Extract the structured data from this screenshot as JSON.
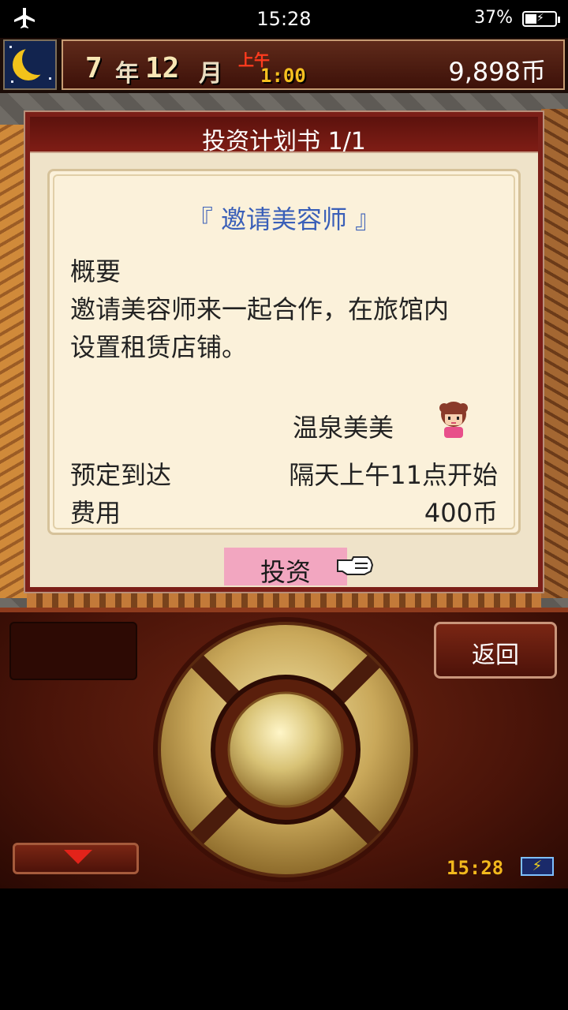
{
  "status_bar": {
    "time": "15:28",
    "battery_percent": "37%",
    "battery_level": 0.37,
    "icons": [
      "airplane-mode-icon",
      "battery-charging-icon"
    ]
  },
  "hud": {
    "year_num": "7",
    "year_unit": "年",
    "month_num": "12",
    "month_unit": "月",
    "am_pm": "上午",
    "clock": "1:00",
    "money": "9,898币",
    "icon": "crescent-moon-icon"
  },
  "dialog": {
    "title": "投资计划书 1/1",
    "plan_name": "『 邀请美容师 』",
    "summary_label": "概要",
    "summary_line1": "邀请美容师来一起合作，在旅馆内",
    "summary_line2": "设置租赁店铺。",
    "person_name": "温泉美美",
    "arrival_label": "预定到达",
    "arrival_value": "隔天上午11点开始",
    "cost_label": "费用",
    "cost_value": "400币",
    "invest_button": "投资",
    "colors": {
      "accent_blue": "#3a5fb8",
      "button_pink": "#f2a6c0"
    }
  },
  "controls": {
    "back_button": "返回",
    "corner_time": "15:28",
    "corner_battery_icon": "⚡"
  }
}
